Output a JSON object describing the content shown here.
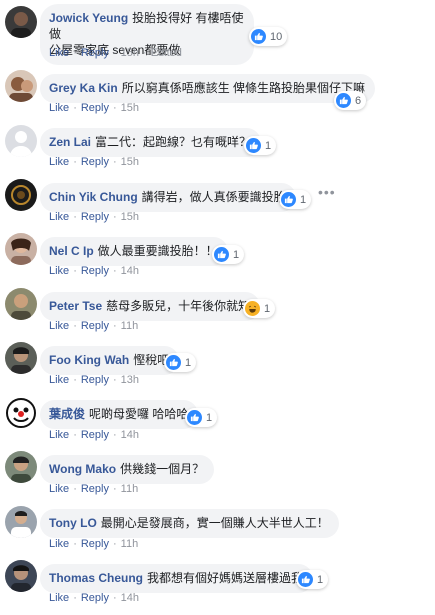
{
  "actions": {
    "like": "Like",
    "reply": "Reply",
    "dot": "·",
    "edited": "Edited"
  },
  "comments": [
    {
      "author": "Jowick Yeung",
      "text": "投胎投得好 有樓唔使做",
      "text2": "公屋零家底 seven都要做",
      "time": "15h",
      "edited": true,
      "react_count": "10",
      "react": "like"
    },
    {
      "author": "Grey Ka Kin",
      "text": "所以窮真係唔應該生 俾條生路投胎果個仔下嘛",
      "time": "15h",
      "react_count": "6",
      "react": "like"
    },
    {
      "author": "Zen Lai",
      "text": "富二代：起跑線？乜有嘅咩？",
      "time": "15h",
      "react_count": "1",
      "react": "like"
    },
    {
      "author": "Chin Yik Chung",
      "text": "講得岩，做人真係要識投胎",
      "time": "15h",
      "react_count": "1",
      "react": "like"
    },
    {
      "author": "Nel C Ip",
      "text": "做人最重要識投胎！！",
      "time": "14h",
      "react_count": "1",
      "react": "like"
    },
    {
      "author": "Peter Tse",
      "text": "慈母多販兒，十年後你就知",
      "time": "11h",
      "react_count": "1",
      "react": "haha"
    },
    {
      "author": "Foo King Wah",
      "text": "慳稅吧",
      "time": "13h",
      "react_count": "1",
      "react": "like"
    },
    {
      "author": "葉成俊",
      "text": "呢啲母愛囉 哈哈哈",
      "time": "14h",
      "react_count": "1",
      "react": "like"
    },
    {
      "author": "Wong Mako",
      "text": "供幾錢一個月？",
      "time": "11h",
      "react_count": "",
      "react": ""
    },
    {
      "author": "Tony LO",
      "text": "最開心是發展商，實一個賺人大半世人工！",
      "time": "11h",
      "react_count": "",
      "react": ""
    },
    {
      "author": "Thomas Cheung",
      "text": "我都想有個好媽媽送層樓過我",
      "time": "14h",
      "react_count": "1",
      "react": "like"
    }
  ],
  "colors": {
    "link": "#385898",
    "bubble": "#f2f3f5",
    "meta": "#90949c",
    "like_blue": "#2d88ff"
  }
}
